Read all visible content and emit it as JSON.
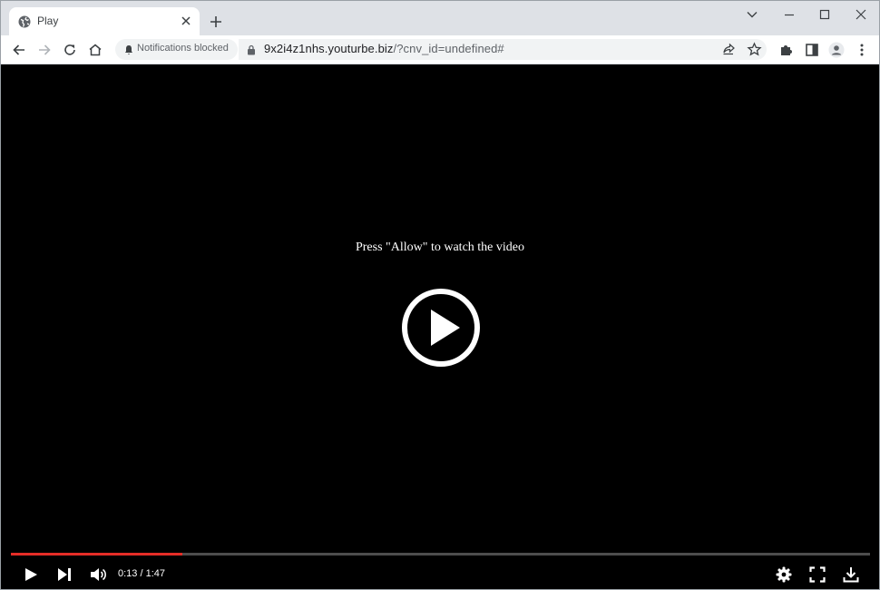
{
  "browser": {
    "tab": {
      "title": "Play"
    },
    "notifications_chip": "Notifications blocked",
    "url": {
      "host": "9x2i4z1nhs.youturbe.biz",
      "path": "/?cnv_id=undefined#"
    }
  },
  "player": {
    "prompt": "Press \"Allow\" to watch the video",
    "current_time": "0:13",
    "duration": "1:47",
    "time_separator": " / ",
    "progress_fraction": 0.2,
    "progress_color": "#e52d27"
  }
}
